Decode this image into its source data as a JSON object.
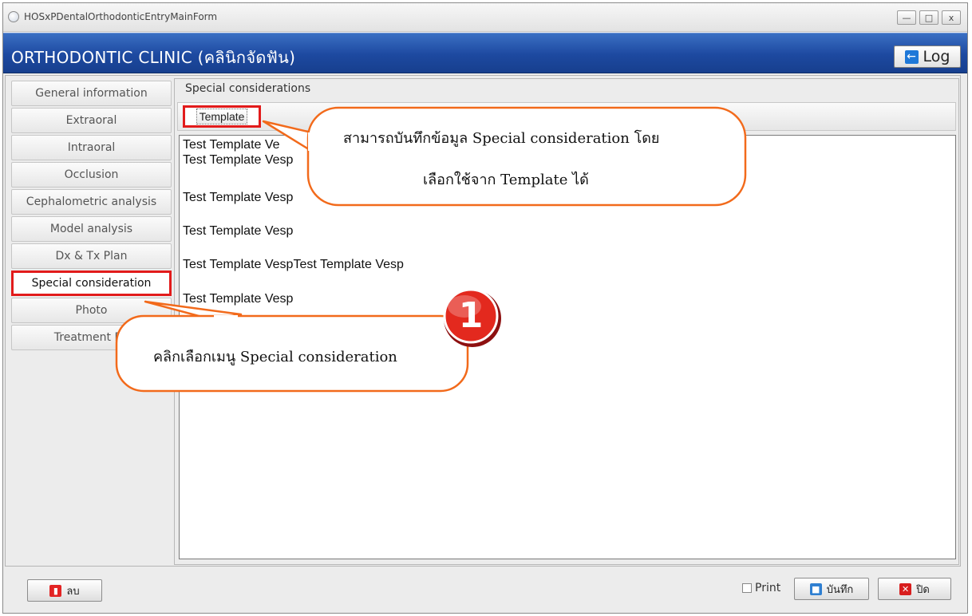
{
  "window": {
    "title": "HOSxPDentalOrthodonticEntryMainForm"
  },
  "window_controls": {
    "minimize": "—",
    "maximize": "□",
    "close": "x"
  },
  "header": {
    "title": "ORTHODONTIC CLINIC (คลินิกจัดฟัน)",
    "log_label": "Log",
    "log_icon": "exit-arrow-icon"
  },
  "sidebar": {
    "items": [
      {
        "label": "General information"
      },
      {
        "label": "Extraoral"
      },
      {
        "label": "Intraoral"
      },
      {
        "label": "Occlusion"
      },
      {
        "label": "Cephalometric analysis"
      },
      {
        "label": "Model analysis"
      },
      {
        "label": "Dx & Tx Plan"
      },
      {
        "label": "Special consideration"
      },
      {
        "label": "Photo"
      },
      {
        "label": "Treatment Re"
      }
    ],
    "selected": "Special consideration"
  },
  "panel": {
    "title": "Special considerations",
    "template_label": "Template",
    "lines": [
      "Test Template Ve",
      "Test Template Vesp",
      "Test Template Vesp",
      "Test Template Vesp",
      "Test Template VespTest Template Vesp",
      "Test Template Vesp"
    ]
  },
  "callouts": {
    "top_line1": "สามารถบันทึกข้อมูล Special consideration โดย",
    "top_line2": "เลือกใช้จาก Template ได้",
    "bottom_text": "คลิกเลือกเมนู Special consideration",
    "step_number": "1"
  },
  "footer": {
    "delete_label": "ลบ",
    "print_label": "Print",
    "save_label": "บันทึก",
    "close_label": "ปิด"
  },
  "colors": {
    "header_blue": "#1d49a0",
    "highlight_red": "#e21b1b",
    "callout_orange": "#f26a1b"
  }
}
